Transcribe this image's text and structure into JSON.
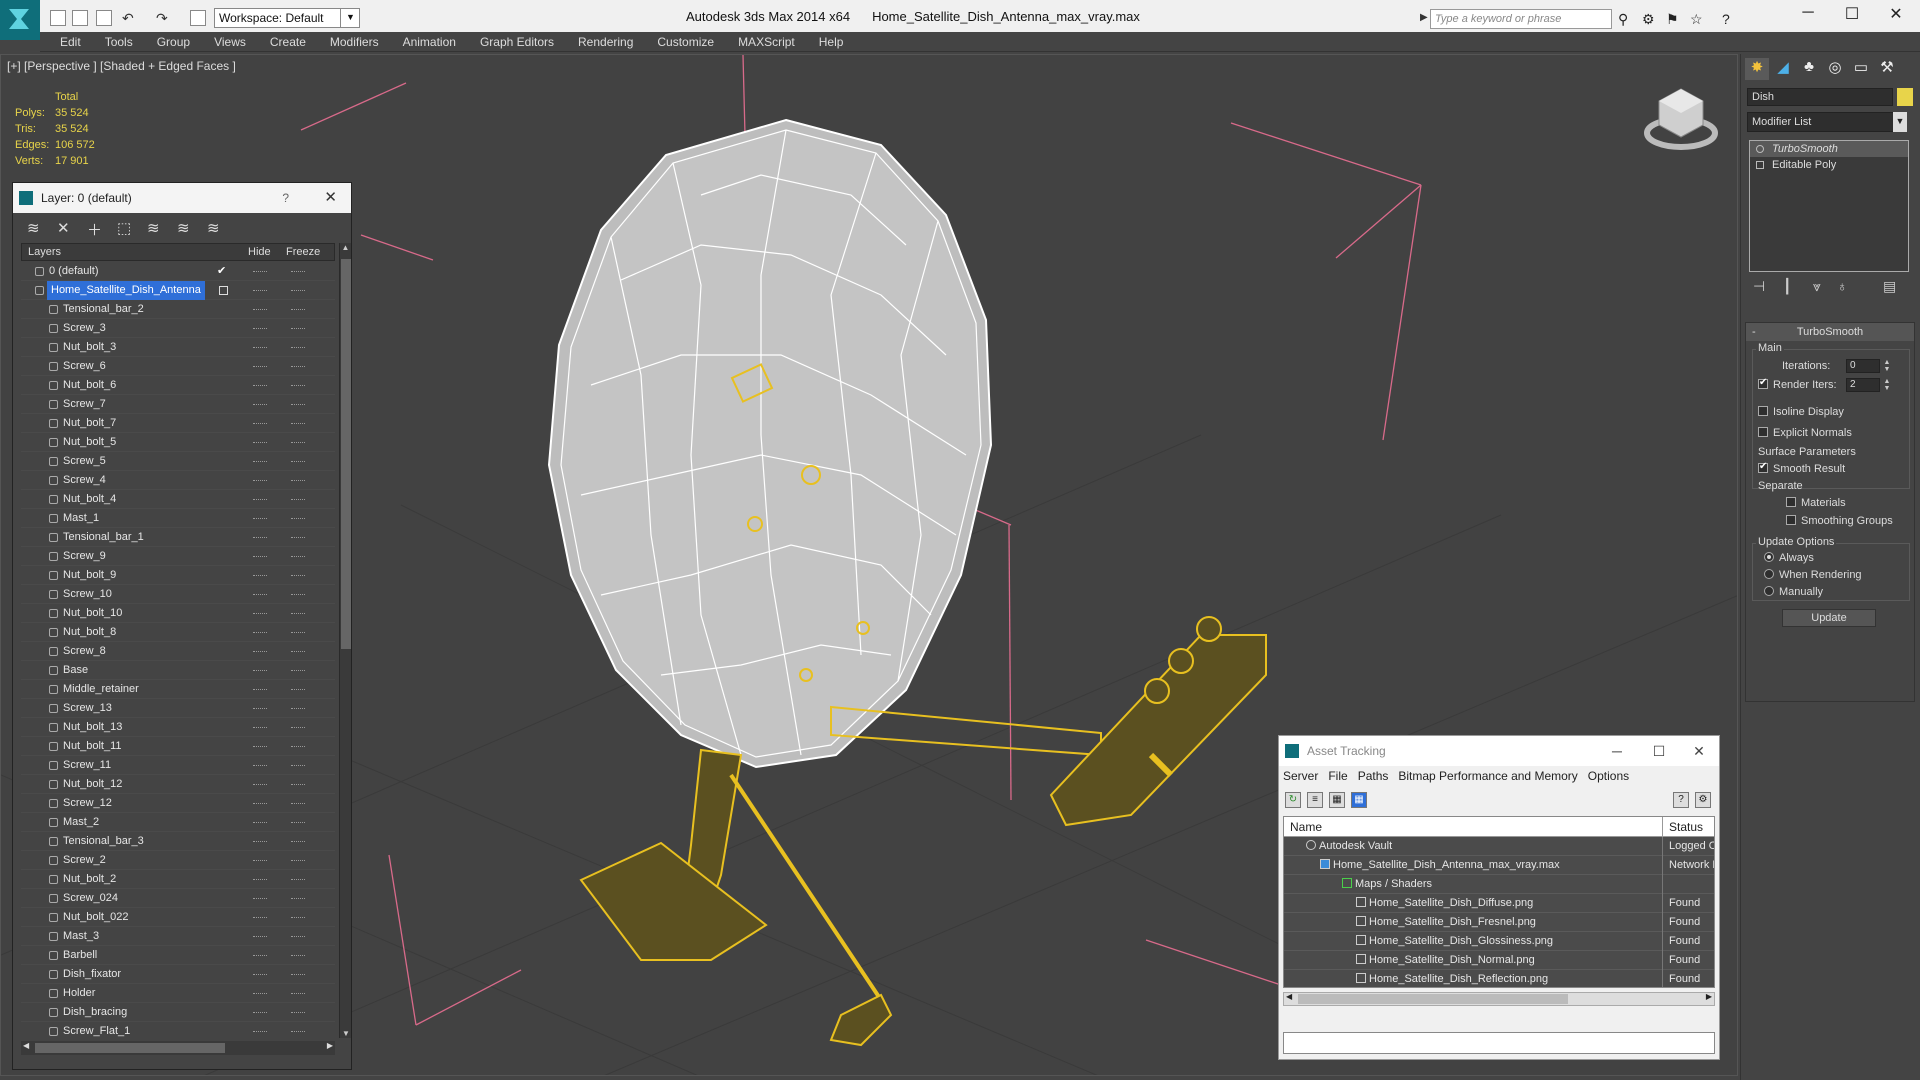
{
  "titlebar": {
    "workspace": "Workspace: Default",
    "app_title": "Autodesk 3ds Max  2014 x64",
    "file_title": "Home_Satellite_Dish_Antenna_max_vray.max",
    "search_placeholder": "Type a keyword or phrase"
  },
  "menu": [
    "Edit",
    "Tools",
    "Group",
    "Views",
    "Create",
    "Modifiers",
    "Animation",
    "Graph Editors",
    "Rendering",
    "Customize",
    "MAXScript",
    "Help"
  ],
  "viewport": {
    "label": "[+] [Perspective ] [Shaded + Edged Faces ]",
    "stats_header": "Total",
    "stats": [
      {
        "label": "Polys:",
        "value": "35 524"
      },
      {
        "label": "Tris:",
        "value": "35 524"
      },
      {
        "label": "Edges:",
        "value": "106 572"
      },
      {
        "label": "Verts:",
        "value": "17 901"
      }
    ]
  },
  "layer_panel": {
    "title": "Layer: 0 (default)",
    "help": "?",
    "col_layers": "Layers",
    "col_hide": "Hide",
    "col_freeze": "Freeze",
    "default_layer": "0 (default)",
    "selected_layer": "Home_Satellite_Dish_Antenna",
    "objects": [
      "Tensional_bar_2",
      "Screw_3",
      "Nut_bolt_3",
      "Screw_6",
      "Nut_bolt_6",
      "Screw_7",
      "Nut_bolt_7",
      "Nut_bolt_5",
      "Screw_5",
      "Screw_4",
      "Nut_bolt_4",
      "Mast_1",
      "Tensional_bar_1",
      "Screw_9",
      "Nut_bolt_9",
      "Screw_10",
      "Nut_bolt_10",
      "Nut_bolt_8",
      "Screw_8",
      "Base",
      "Middle_retainer",
      "Screw_13",
      "Nut_bolt_13",
      "Nut_bolt_11",
      "Screw_11",
      "Nut_bolt_12",
      "Screw_12",
      "Mast_2",
      "Tensional_bar_3",
      "Screw_2",
      "Nut_bolt_2",
      "Screw_024",
      "Nut_bolt_022",
      "Mast_3",
      "Barbell",
      "Dish_fixator",
      "Holder",
      "Dish_bracing",
      "Screw_Flat_1"
    ]
  },
  "command_panel": {
    "object_name": "Dish",
    "object_color": "#e8d44a",
    "modifier_list": "Modifier List",
    "stack": [
      "TurboSmooth",
      "Editable Poly"
    ],
    "rollout_title": "TurboSmooth",
    "main_label": "Main",
    "iterations_label": "Iterations:",
    "iterations_value": "0",
    "render_iters_label": "Render Iters:",
    "render_iters_value": "2",
    "isoline": "Isoline Display",
    "explicit": "Explicit Normals",
    "surface_label": "Surface Parameters",
    "smooth_result": "Smooth Result",
    "separate": "Separate",
    "materials": "Materials",
    "smoothing_groups": "Smoothing Groups",
    "update_options": "Update Options",
    "always": "Always",
    "when_rendering": "When Rendering",
    "manually": "Manually",
    "update_button": "Update"
  },
  "asset_tracking": {
    "title": "Asset Tracking",
    "menu": [
      "Server",
      "File",
      "Paths",
      "Bitmap Performance and Memory",
      "Options"
    ],
    "col_name": "Name",
    "col_status": "Status",
    "rows": [
      {
        "name": "Autodesk Vault",
        "status": "Logged O"
      },
      {
        "name": "Home_Satellite_Dish_Antenna_max_vray.max",
        "status": "Network F"
      },
      {
        "name": "Maps / Shaders",
        "status": ""
      },
      {
        "name": "Home_Satellite_Dish_Diffuse.png",
        "status": "Found"
      },
      {
        "name": "Home_Satellite_Dish_Fresnel.png",
        "status": "Found"
      },
      {
        "name": "Home_Satellite_Dish_Glossiness.png",
        "status": "Found"
      },
      {
        "name": "Home_Satellite_Dish_Normal.png",
        "status": "Found"
      },
      {
        "name": "Home_Satellite_Dish_Reflection.png",
        "status": "Found"
      }
    ]
  },
  "colors": {
    "selection": "#e8c020",
    "wire": "#ffffff",
    "bbox": "#d86a8a",
    "accent": "#2f6fd8"
  }
}
